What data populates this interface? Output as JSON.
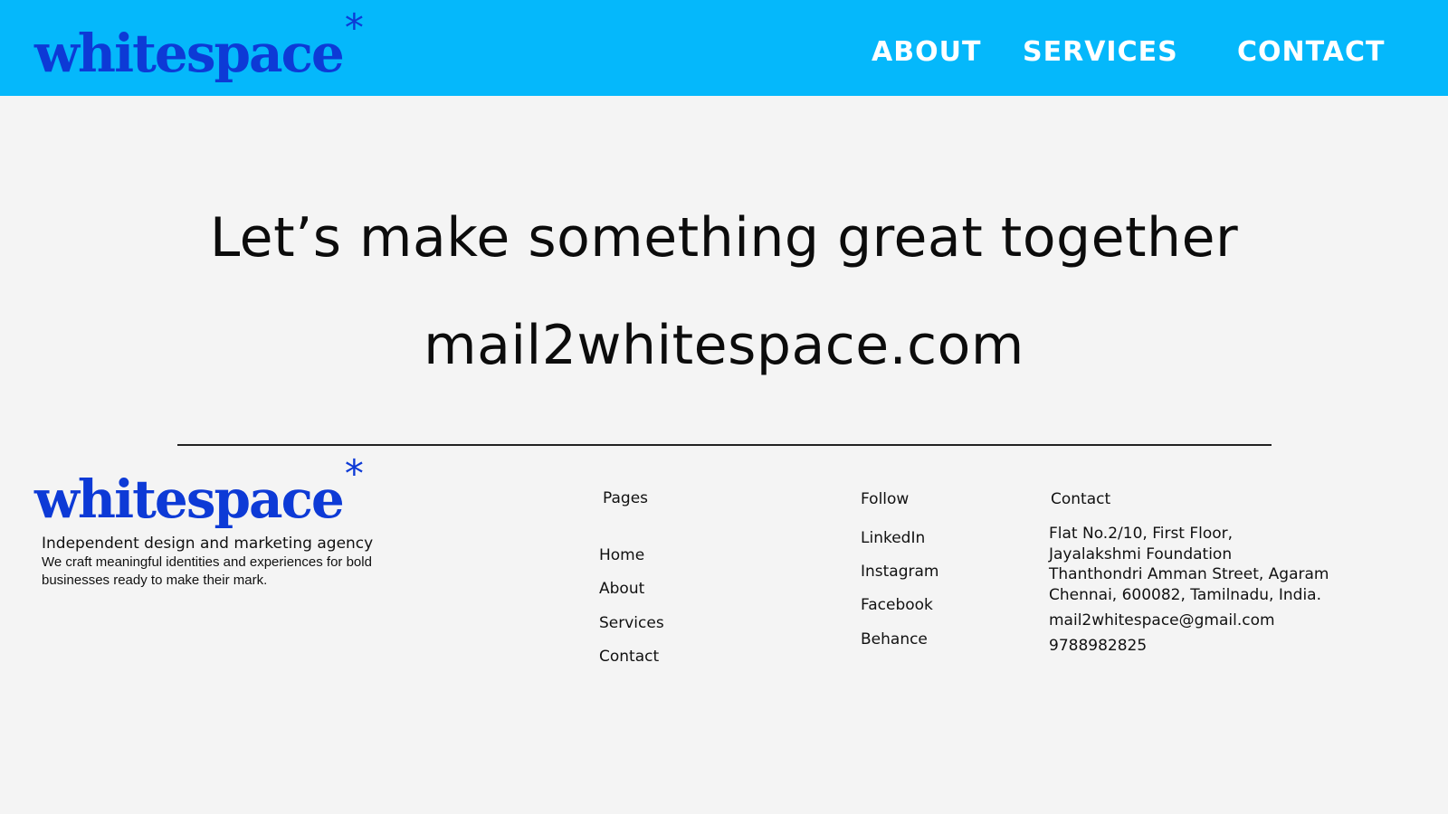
{
  "brand": {
    "name": "whitespace",
    "star": "*",
    "color": "#0d3ad6"
  },
  "header": {
    "bg": "#05b8fb",
    "nav": [
      {
        "label": "ABOUT"
      },
      {
        "label": "SERVICES"
      },
      {
        "label": "CONTACT"
      }
    ]
  },
  "hero": {
    "title": "Let’s make something great together",
    "email": "mail2whitespace.com"
  },
  "footer": {
    "tagline": "Independent design and marketing agency",
    "description": "We craft meaningful identities and experiences for bold businesses ready to make their mark.",
    "pages": {
      "heading": "Pages",
      "links": [
        "Home",
        "About",
        "Services",
        "Contact"
      ]
    },
    "follow": {
      "heading": "Follow",
      "links": [
        "LinkedIn",
        "Instagram",
        "Facebook",
        "Behance"
      ]
    },
    "contact": {
      "heading": "Contact",
      "address_lines": [
        "Flat No.2/10, First Floor,",
        "Jayalakshmi Foundation",
        "Thanthondri Amman Street, Agaram",
        "Chennai, 600082, Tamilnadu, India."
      ],
      "email": "mail2whitespace@gmail.com",
      "phone": "9788982825"
    }
  }
}
